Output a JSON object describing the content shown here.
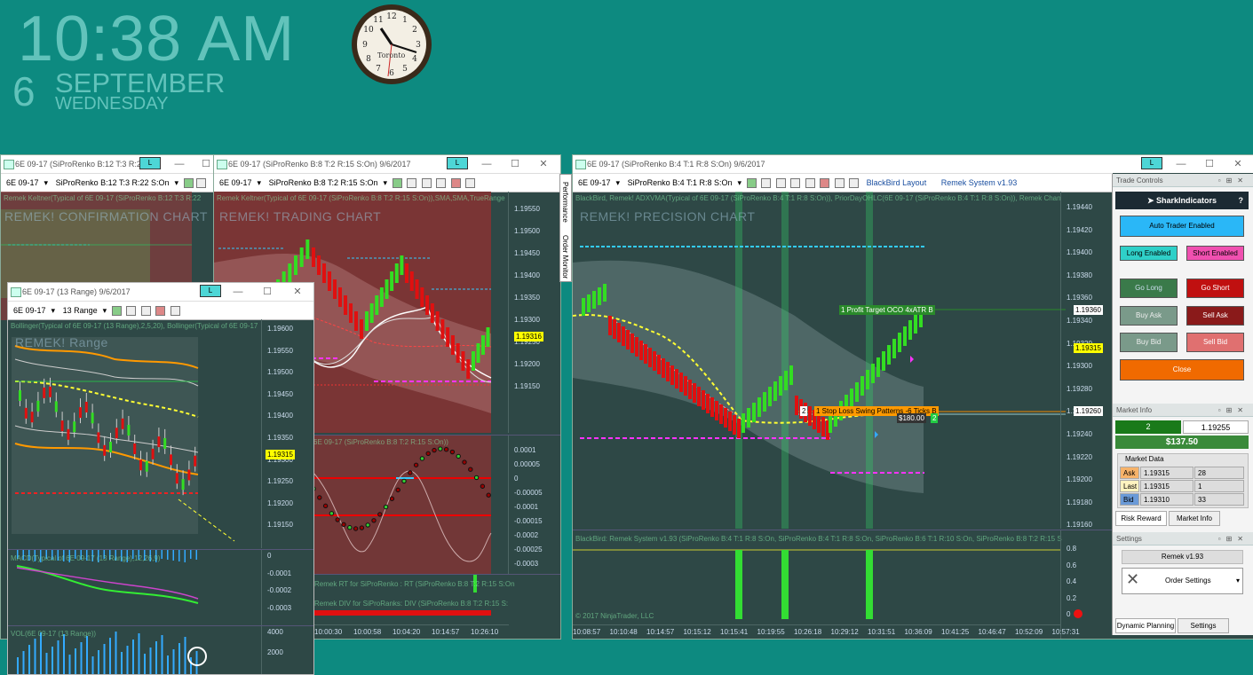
{
  "desktop": {
    "time": "10:38 AM",
    "day": "6",
    "month": "SEPTEMBER",
    "weekday": "WEDNESDAY",
    "clock_city": "Toronto"
  },
  "win_confirm": {
    "title": "6E 09-17 (SiProRenko B:12 T:3 R:22",
    "tab": "L",
    "instrument": "6E 09-17",
    "bartype": "SiProRenko B:12 T:3 R:22 S:On",
    "panel_label": "Remek Keltner(Typical of 6E 09-17 (SiProRenko B:12 T:3 R:22",
    "chart_title": "REMEK! CONFIRMATION CHART"
  },
  "win_trading": {
    "title": "6E 09-17 (SiProRenko B:8 T:2 R:15 S:On)  9/6/2017",
    "tab": "L",
    "instrument": "6E 09-17",
    "bartype": "SiProRenko B:8 T:2 R:15 S:On",
    "panel_label": "Remek Keltner(Typical of 6E 09-17 (SiProRenko B:8 T:2 R:15 S:On)),SMA,SMA,TrueRange",
    "chart_title": "REMEK! TRADING CHART",
    "osc_label": "6E 09-17 (SiProRenko B:8 T:2 R:15 S:On))",
    "rt_label": "Remek RT for SiProRenko : RT (SiProRenko B:8 T:2 R:15 S:On",
    "div_label": "Remek DIV for SiProRanks: DIV (SiProRenko B:8 T:2 R:15 S:",
    "price_axis": [
      "1.19550",
      "1.19500",
      "1.19450",
      "1.19400",
      "1.19350",
      "1.19300",
      "1.19250",
      "1.19200",
      "1.19150"
    ],
    "osc_axis": [
      "0.0001",
      "0.00005",
      "0",
      "-0.00005",
      "-0.0001",
      "-0.00015",
      "-0.0002",
      "-0.00025",
      "-0.0003"
    ],
    "current_price": "1.19316",
    "times": [
      "10:00:30",
      "10:00:58",
      "10:04:20",
      "10:14:57",
      "10:26:10"
    ]
  },
  "win_range": {
    "title": "6E 09-17 (13 Range)  9/6/2017",
    "tab": "L",
    "instrument": "6E 09-17",
    "bartype": "13 Range",
    "panel_label": "Bollinger(Typical of 6E 09-17 (13 Range),2,5,20), Bollinger(Typical of 6E 09-17",
    "chart_title": "REMEK! Range",
    "price_axis": [
      "1.19600",
      "1.19550",
      "1.19500",
      "1.19450",
      "1.19400",
      "1.19350",
      "1.19300",
      "1.19250",
      "1.19200",
      "1.19150"
    ],
    "current_price": "1.19315",
    "macd_label": "MACD(Typical of 6E 09-17 (13 Range),12,26,9)",
    "macd_axis": [
      "0",
      "-0.0001",
      "-0.0002",
      "-0.0003"
    ],
    "vol_label": "VOL(6E 09-17 (13 Range))",
    "vol_axis": [
      "4000",
      "2000"
    ]
  },
  "win_precision": {
    "title": "6E 09-17 (SiProRenko B:4 T:1 R:8 S:On)  9/6/2017",
    "tab": "L",
    "instrument": "6E 09-17",
    "bartype": "SiProRenko B:4 T:1 R:8 S:On",
    "layout_link": "BlackBird Layout",
    "system_link": "Remek System v1.93",
    "panel_label": "BlackBird, Remek! ADXVMA(Typical of 6E 09-17 (SiProRenko B:4 T:1 R:8 S:On)), PriorDayOHLC(6E 09-17 (SiProRenko B:4 T:1 R:8 S:On)), Remek Chan",
    "chart_title": "REMEK! PRECISION CHART",
    "price_axis": [
      "1.19440",
      "1.19420",
      "1.19400",
      "1.19380",
      "1.19360",
      "1.19340",
      "1.19320",
      "1.19300",
      "1.19280",
      "1.19260",
      "1.19240",
      "1.19220",
      "1.19200",
      "1.19180",
      "1.19160"
    ],
    "profit_target": "1  Profit Target OCO  4xATR B",
    "stop_loss": "1  Stop Loss Swing Patterns -6 Ticks B",
    "stop_qty": "2",
    "pnl_tag": "$180.00",
    "pnl_qty": "2",
    "tag_target": "1.19360",
    "tag_current": "1.19315",
    "tag_stop": "1.19260",
    "system_label": "BlackBird: Remek System v1.93 (SiProRenko B:4 T:1 R:8 S:On, SiProRenko B:4 T:1 R:8 S:On, SiProRenko B:6 T:1 R:10 S:On, SiProRenko B:8 T:2 R:15 S",
    "sys_axis": [
      "0.8",
      "0.6",
      "0.4",
      "0.2",
      "0"
    ],
    "copyright": "© 2017 NinjaTrader, LLC",
    "times": [
      "10:08:57",
      "10:10:48",
      "10:14:57",
      "10:15:12",
      "10:15:41",
      "10:19:55",
      "10:26:18",
      "10:29:12",
      "10:31:51",
      "10:36:09",
      "10:41:25",
      "10:46:47",
      "10:52:09",
      "10:57:31"
    ]
  },
  "side_tabs": [
    "Performance",
    "Order Monitor"
  ],
  "trade_controls": {
    "header": "Trade Controls",
    "brand": "SharkIndicators",
    "auto_trader": "Auto Trader Enabled",
    "long_enabled": "Long Enabled",
    "short_enabled": "Short Enabled",
    "go_long": "Go Long",
    "go_short": "Go Short",
    "buy_ask": "Buy Ask",
    "sell_ask": "Sell Ask",
    "buy_bid": "Buy Bid",
    "sell_bid": "Sell Bid",
    "close": "Close"
  },
  "market_info": {
    "header": "Market Info",
    "position": "2",
    "price": "1.19255",
    "pnl": "$137.50",
    "market_data_label": "Market Data",
    "rows": [
      {
        "label": "Ask",
        "price": "1.19315",
        "size": "28"
      },
      {
        "label": "Last",
        "price": "1.19315",
        "size": "1"
      },
      {
        "label": "Bid",
        "price": "1.19310",
        "size": "33"
      }
    ],
    "tab_risk": "Risk Reward",
    "tab_market": "Market Info"
  },
  "settings": {
    "header": "Settings",
    "version": "Remek v1.93",
    "order_settings": "Order Settings",
    "tab_dynamic": "Dynamic Planning",
    "tab_settings": "Settings"
  },
  "colors": {
    "desktop": "#0d8a80",
    "bull": "#33dd22",
    "bear": "#e01010",
    "panel_bg": "#2e4846",
    "trading_bg": "#7a3535"
  }
}
